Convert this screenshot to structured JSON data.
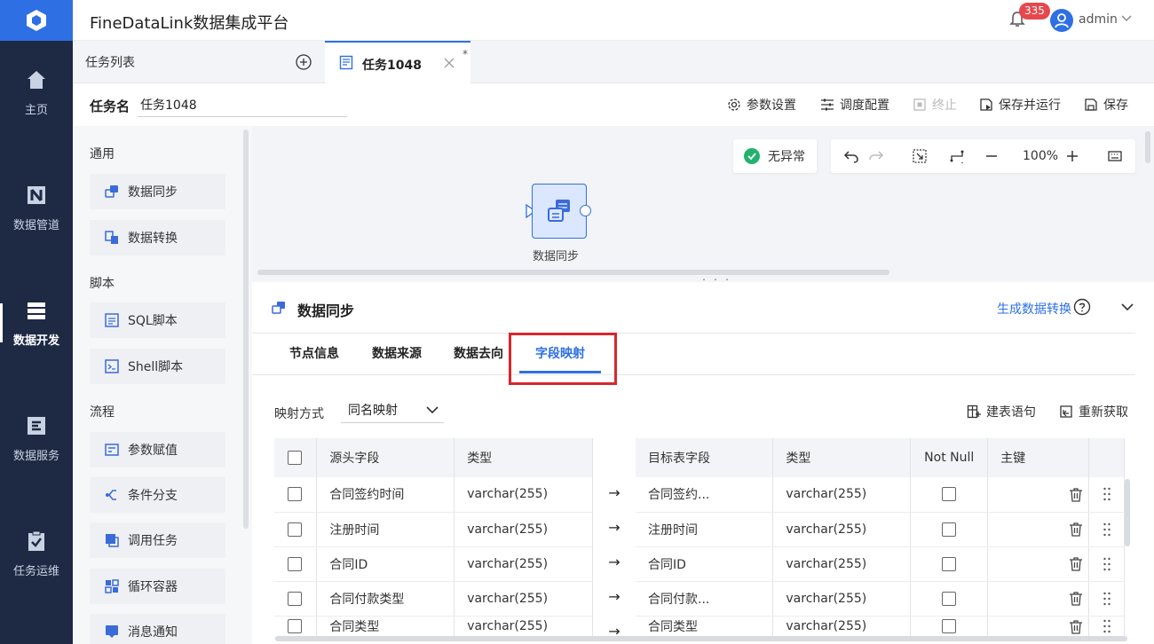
{
  "app": {
    "title": "FineDataLink数据集成平台",
    "notification_count": "335",
    "user": "admin"
  },
  "nav": [
    {
      "label": "主页",
      "icon": "home-icon"
    },
    {
      "label": "数据管道",
      "icon": "pipeline-icon"
    },
    {
      "label": "数据开发",
      "icon": "dev-icon",
      "active": true
    },
    {
      "label": "数据服务",
      "icon": "service-icon"
    },
    {
      "label": "任务运维",
      "icon": "ops-icon"
    }
  ],
  "tabs": {
    "list_label": "任务列表",
    "active_label": "任务1048",
    "modified_mark": "*"
  },
  "task": {
    "name_label": "任务名",
    "name_value": "任务1048"
  },
  "toolbar": {
    "params": "参数设置",
    "schedule": "调度配置",
    "stop": "终止",
    "save_run": "保存并运行",
    "save": "保存"
  },
  "palette": {
    "sections": [
      "通用",
      "脚本",
      "流程"
    ],
    "items": [
      "数据同步",
      "数据转换",
      "SQL脚本",
      "Shell脚本",
      "参数赋值",
      "条件分支",
      "调用任务",
      "循环容器",
      "消息通知"
    ]
  },
  "canvas": {
    "status": "无异常",
    "zoom": "100%",
    "node_label": "数据同步"
  },
  "panel": {
    "title": "数据同步",
    "generate_link": "生成数据转换",
    "tabs": [
      "节点信息",
      "数据来源",
      "数据去向",
      "字段映射"
    ],
    "active_tab": "字段映射",
    "mapping_label": "映射方式",
    "mapping_value": "同名映射",
    "create_sql": "建表语句",
    "refetch": "重新获取"
  },
  "table": {
    "source_headers": [
      "源头字段",
      "类型"
    ],
    "target_headers": [
      "目标表字段",
      "类型",
      "Not Null",
      "主键"
    ],
    "rows": [
      {
        "source": "合同签约时间",
        "stype": "varchar(255)",
        "target": "合同签约...",
        "ttype": "varchar(255)"
      },
      {
        "source": "注册时间",
        "stype": "varchar(255)",
        "target": "注册时间",
        "ttype": "varchar(255)"
      },
      {
        "source": "合同ID",
        "stype": "varchar(255)",
        "target": "合同ID",
        "ttype": "varchar(255)"
      },
      {
        "source": "合同付款类型",
        "stype": "varchar(255)",
        "target": "合同付款...",
        "ttype": "varchar(255)"
      },
      {
        "source": "合同类型",
        "stype": "varchar(255)",
        "target": "合同类型",
        "ttype": "varchar(255)"
      }
    ]
  },
  "colors": {
    "accent": "#2e6fe4",
    "nav_bg": "#1e2a44",
    "highlight": "#d9262b",
    "ok": "#23b26d"
  }
}
